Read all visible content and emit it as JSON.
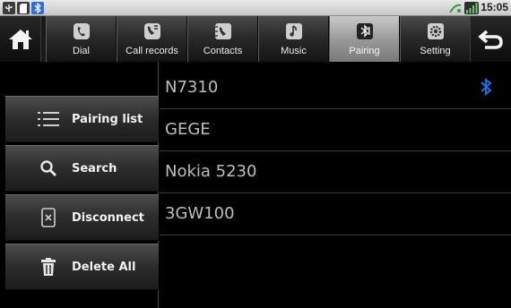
{
  "status_bar": {
    "time": "15:05",
    "icons": [
      "usb-icon",
      "sd-card-icon",
      "bluetooth-icon",
      "signal-icon",
      "signal-bars-icon"
    ]
  },
  "nav": {
    "home_icon": "home-icon",
    "back_icon": "back-arrow-icon",
    "tabs": [
      {
        "label": "Dial",
        "icon": "phone-icon",
        "active": false
      },
      {
        "label": "Call records",
        "icon": "call-log-icon",
        "active": false
      },
      {
        "label": "Contacts",
        "icon": "contacts-icon",
        "active": false
      },
      {
        "label": "Music",
        "icon": "music-icon",
        "active": false
      },
      {
        "label": "Pairing",
        "icon": "bluetooth-icon",
        "active": true
      },
      {
        "label": "Setting",
        "icon": "gear-icon",
        "active": false
      }
    ]
  },
  "sidebar": {
    "buttons": [
      {
        "label": "Pairing list",
        "icon": "list-icon"
      },
      {
        "label": "Search",
        "icon": "search-icon"
      },
      {
        "label": "Disconnect",
        "icon": "disconnect-icon"
      },
      {
        "label": "Delete All",
        "icon": "trash-icon"
      }
    ]
  },
  "devices": [
    {
      "name": "N7310",
      "connected": true
    },
    {
      "name": "GEGE",
      "connected": false
    },
    {
      "name": "Nokia 5230",
      "connected": false
    },
    {
      "name": "3GW100",
      "connected": false
    }
  ],
  "colors": {
    "accent_bluetooth": "#1e6fe0",
    "background": "#000000",
    "device_text": "#bdbdbd"
  }
}
